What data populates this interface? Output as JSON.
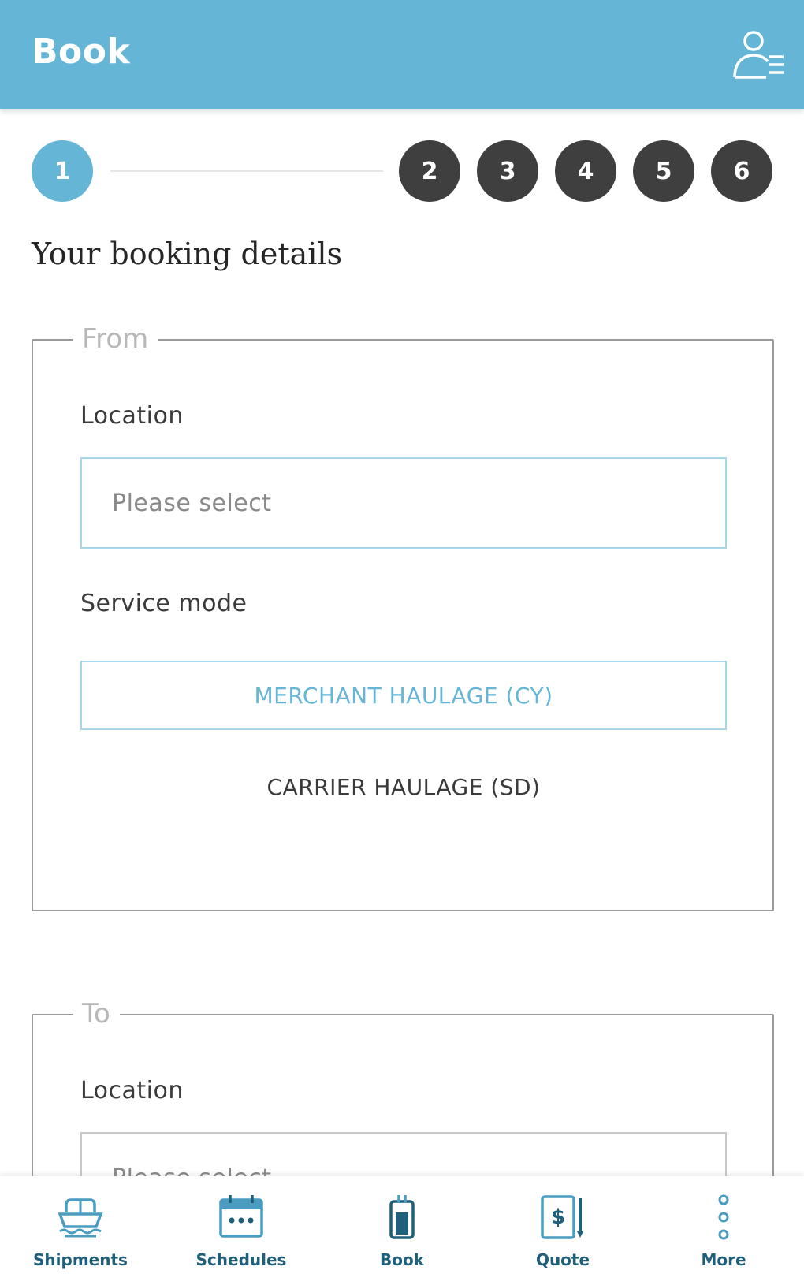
{
  "header": {
    "title": "Book",
    "profile_icon": "user-settings-icon"
  },
  "stepper": {
    "steps": [
      "1",
      "2",
      "3",
      "4",
      "5",
      "6"
    ],
    "active_index": 0,
    "colors": {
      "active": "#64b5d6",
      "inactive": "#3f3f3f"
    }
  },
  "page": {
    "section_title": "Your booking details"
  },
  "from": {
    "legend": "From",
    "location_label": "Location",
    "location_placeholder": "Please select",
    "service_mode_label": "Service mode",
    "mode_selected": "MERCHANT HAULAGE (CY)",
    "mode_other": "CARRIER HAULAGE (SD)"
  },
  "to": {
    "legend": "To",
    "location_label": "Location",
    "location_placeholder": "Please select"
  },
  "bottom_nav": {
    "items": [
      {
        "label": "Shipments",
        "icon": "ship-icon"
      },
      {
        "label": "Schedules",
        "icon": "calendar-icon"
      },
      {
        "label": "Book",
        "icon": "book-container-icon"
      },
      {
        "label": "Quote",
        "icon": "quote-icon"
      },
      {
        "label": "More",
        "icon": "more-vertical-icon"
      }
    ]
  },
  "colors": {
    "brand": "#64b5d6",
    "nav_text": "#1f5f7a",
    "border": "#9a9a9a"
  }
}
